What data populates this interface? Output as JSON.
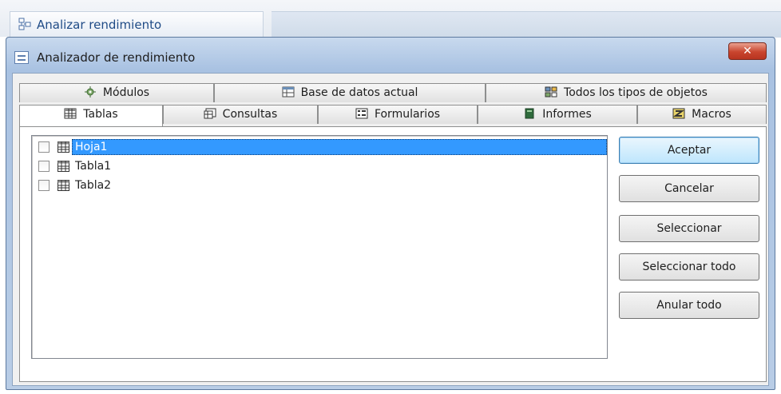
{
  "window": {
    "ribbon_tab_label": "Analizar rendimiento",
    "dialog_title": "Analizador de rendimiento",
    "close_glyph": "✕"
  },
  "tabs": {
    "row_back": [
      {
        "label": "Módulos",
        "icon": "modules-icon"
      },
      {
        "label": "Base de datos actual",
        "icon": "database-icon"
      },
      {
        "label": "Todos los tipos de objetos",
        "icon": "all-objects-icon"
      }
    ],
    "row_front": [
      {
        "label": "Tablas",
        "icon": "table-icon",
        "active": true
      },
      {
        "label": "Consultas",
        "icon": "query-icon",
        "active": false
      },
      {
        "label": "Formularios",
        "icon": "form-icon",
        "active": false
      },
      {
        "label": "Informes",
        "icon": "report-icon",
        "active": false
      },
      {
        "label": "Macros",
        "icon": "macro-icon",
        "active": false
      }
    ]
  },
  "list": {
    "items": [
      {
        "label": "Hoja1",
        "checked": false,
        "selected": true
      },
      {
        "label": "Tabla1",
        "checked": false,
        "selected": false
      },
      {
        "label": "Tabla2",
        "checked": false,
        "selected": false
      }
    ]
  },
  "buttons": {
    "aceptar": "Aceptar",
    "cancelar": "Cancelar",
    "seleccionar": "Seleccionar",
    "seleccionar_todo": "Seleccionar todo",
    "anular_todo": "Anular todo"
  },
  "colors": {
    "selection": "#3399ff",
    "title_text": "#1f4b86",
    "close_button": "#c9452e"
  }
}
